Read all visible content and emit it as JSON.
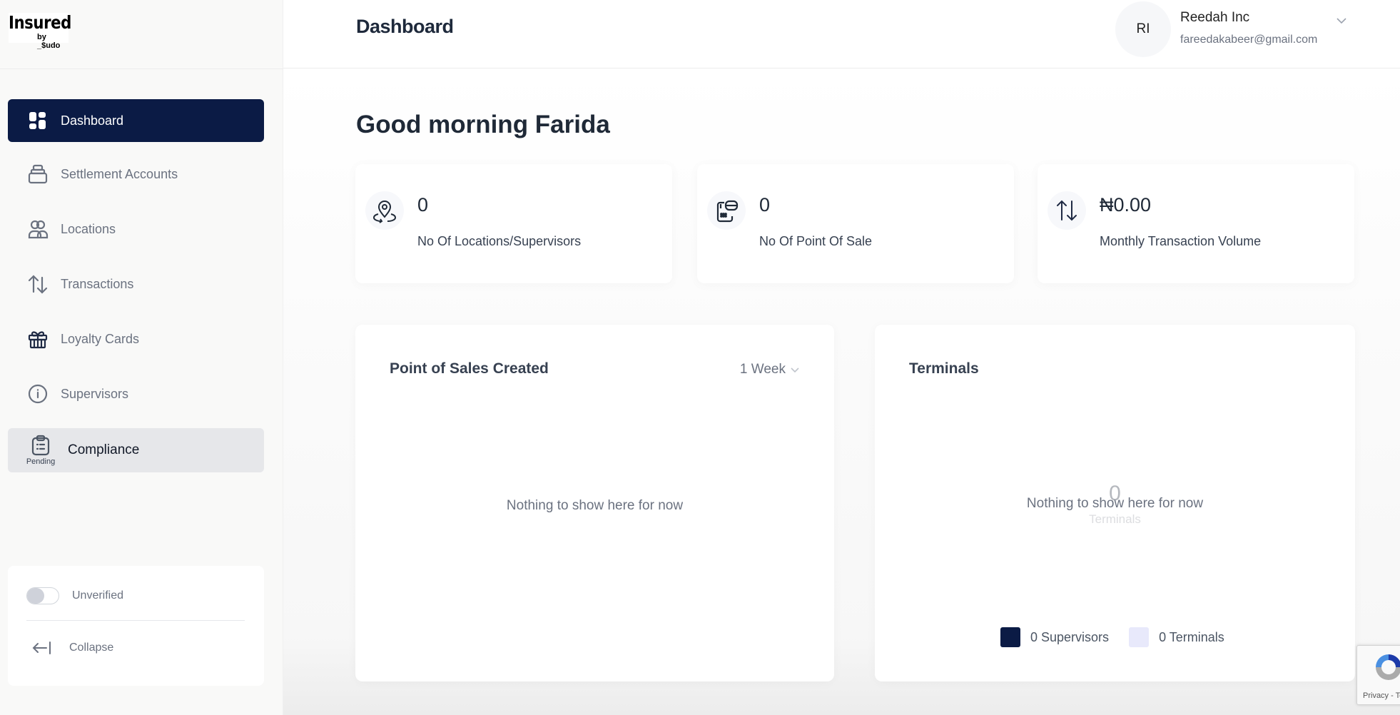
{
  "app": {
    "brand": "Insured",
    "brand_sub": "by _$udo"
  },
  "sidebar": {
    "items": [
      {
        "label": "Dashboard",
        "icon": "dashboard-grid-icon",
        "active": true
      },
      {
        "label": "Settlement Accounts",
        "icon": "stacked-box-icon"
      },
      {
        "label": "Locations",
        "icon": "users-icon"
      },
      {
        "label": "Transactions",
        "icon": "arrows-up-down-icon"
      },
      {
        "label": "Loyalty Cards",
        "icon": "gift-icon"
      },
      {
        "label": "Supervisors",
        "icon": "info-circle-icon"
      },
      {
        "label": "Compliance",
        "icon": "clipboard-list-icon",
        "badge": "Pending"
      }
    ],
    "verification": {
      "label": "Unverified",
      "enabled": false
    },
    "collapse_label": "Collapse"
  },
  "header": {
    "title": "Dashboard",
    "user": {
      "initials": "RI",
      "name": "Reedah Inc",
      "email": "fareedakabeer@gmail.com"
    }
  },
  "main": {
    "greeting": "Good morning Farida",
    "stats": [
      {
        "value": "0",
        "label": "No Of Locations/Supervisors",
        "icon": "location-pin-icon"
      },
      {
        "value": "0",
        "label": "No Of Point Of Sale",
        "icon": "pos-terminal-icon"
      },
      {
        "value": "₦0.00",
        "label": "Monthly Transaction Volume",
        "icon": "arrows-up-down-icon"
      }
    ],
    "pos_panel": {
      "title": "Point of Sales Created",
      "period": "1 Week",
      "empty_message": "Nothing to show here for now"
    },
    "terminals_panel": {
      "title": "Terminals",
      "empty_message": "Nothing to show here for now",
      "center_value": "0",
      "center_caption": "Terminals",
      "legend": [
        {
          "label": "0 Supervisors",
          "color": "#0b1b45"
        },
        {
          "label": "0 Terminals",
          "color": "#e8e9fb"
        }
      ]
    }
  },
  "recaptcha": {
    "text": "Privacy - Terms"
  },
  "colors": {
    "accent": "#0b1b45",
    "sidebar_bg": "#f9f9f8",
    "compliance_bg": "#e6e7ea"
  }
}
